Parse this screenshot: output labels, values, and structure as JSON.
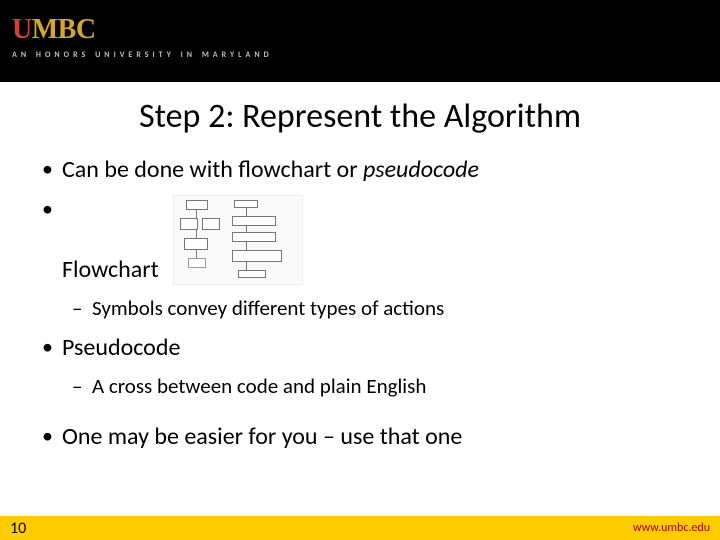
{
  "header": {
    "logo_u": "U",
    "logo_mbc": "MBC",
    "tagline": "AN  HONORS  UNIVERSITY  IN  MARYLAND"
  },
  "title": "Step 2: Represent the Algorithm",
  "bullets": {
    "b1_prefix": "Can be done with flowchart or ",
    "b1_italic": "pseudocode",
    "b2": "Flowchart",
    "b2_sub": "Symbols convey different types of actions",
    "b3": "Pseudocode",
    "b3_sub": "A cross between code and plain English",
    "b4": "One may be easier for you – use that one"
  },
  "footer": {
    "page": "10",
    "site": "www.umbc.edu"
  }
}
